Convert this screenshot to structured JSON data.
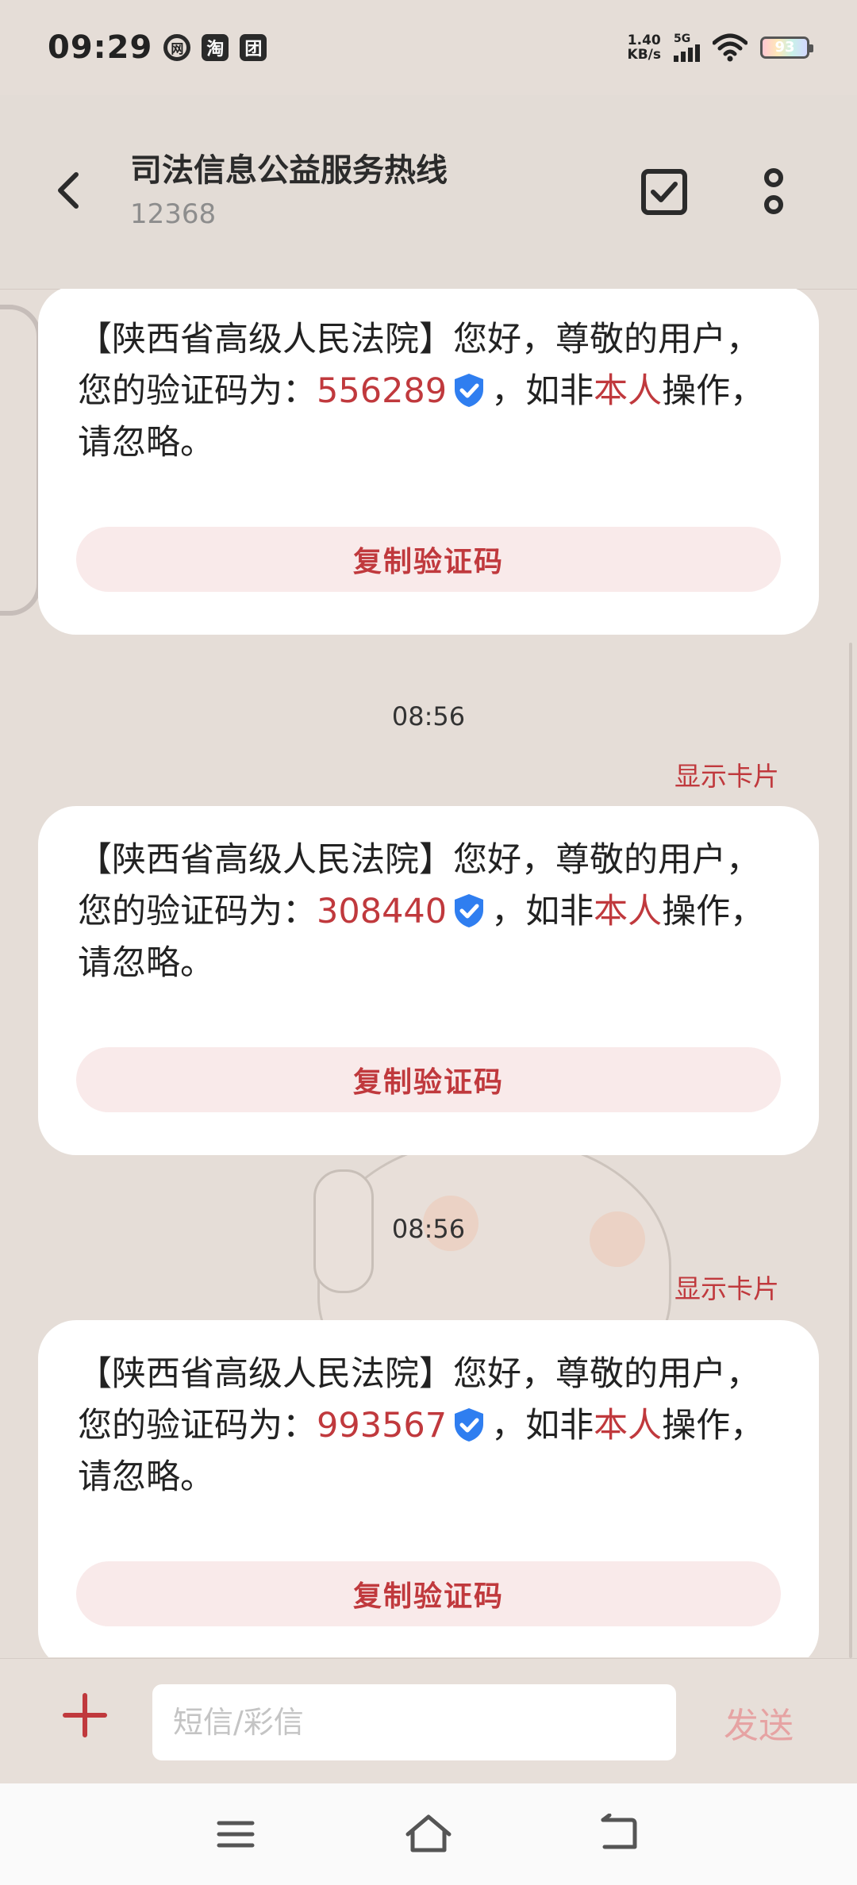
{
  "status_bar": {
    "time": "09:29",
    "app_icons": [
      "网",
      "淘",
      "团"
    ],
    "network_speed_value": "1.40",
    "network_speed_unit": "KB/s",
    "signal_label": "5G",
    "battery": "93"
  },
  "header": {
    "title": "司法信息公益服务热线",
    "subtitle": "12368"
  },
  "messages": [
    {
      "text_before": "【陕西省高级人民法院】您好，尊敬的用户，您的验证码为：",
      "code": "556289",
      "text_middle": "，如非",
      "highlight": "本人",
      "text_after": "操作，请忽略。",
      "copy_label": "复制验证码"
    },
    {
      "timestamp": "08:56",
      "show_card_label": "显示卡片",
      "text_before": "【陕西省高级人民法院】您好，尊敬的用户，您的验证码为：",
      "code": "308440",
      "text_middle": "，如非",
      "highlight": "本人",
      "text_after": "操作，请忽略。",
      "copy_label": "复制验证码"
    },
    {
      "timestamp": "08:56",
      "show_card_label": "显示卡片",
      "text_before": "【陕西省高级人民法院】您好，尊敬的用户，您的验证码为：",
      "code": "993567",
      "text_middle": "，如非",
      "highlight": "本人",
      "text_after": "操作，请忽略。",
      "copy_label": "复制验证码"
    }
  ],
  "composer": {
    "placeholder": "短信/彩信",
    "send_label": "发送"
  },
  "colors": {
    "accent": "#c0393d",
    "background": "#e5ddd7",
    "card": "#ffffff",
    "verified_blue": "#2f7ef0"
  }
}
